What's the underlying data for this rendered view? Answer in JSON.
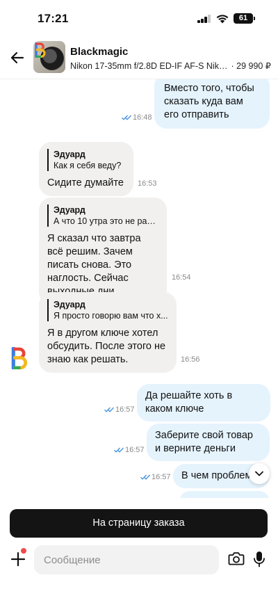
{
  "status": {
    "time": "17:21",
    "battery": "61"
  },
  "header": {
    "seller": "Blackmagic",
    "product": "Nikon 17-35mm f/2.8D ED-IF AF-S Nikkor...",
    "price": "· 29 990 ₽"
  },
  "messages": [
    {
      "dir": "out",
      "text": "Вместо того, чтобы сказать куда вам его отправить",
      "time": "16:48"
    },
    {
      "dir": "in",
      "quote_name": "Эдуард",
      "quote_text": "Как я себя веду?",
      "text": "Сидите думайте",
      "time": "16:53"
    },
    {
      "dir": "in",
      "quote_name": "Эдуард",
      "quote_text": "А что 10 утра это не раб...",
      "text": "Я сказал что завтра всё решим. Зачем писать снова. Это наглость. Сейчас выходные дни.",
      "time": "16:54"
    },
    {
      "dir": "in",
      "quote_name": "Эдуард",
      "quote_text": "Я просто говорю вам что х...",
      "text": "Я в другом ключе хотел обсудить. После этого не знаю как решать.",
      "time": "16:56"
    },
    {
      "dir": "out",
      "text": "Да решайте хоть в каком ключе",
      "time": "16:57"
    },
    {
      "dir": "out",
      "text": "Заберите свой товар и верните деньги",
      "time": "16:57"
    },
    {
      "dir": "out",
      "text": "В чем проблем",
      "time": "16:57"
    }
  ],
  "bottom": {
    "order_button": "На страницу заказа",
    "input_placeholder": "Сообщение"
  },
  "colors": {
    "outgoing": "#e5f3fd",
    "incoming": "#f1f0ee",
    "ticks": "#3d8fe0"
  },
  "icons": [
    "back-arrow-icon",
    "double-check-icon",
    "chevron-down-icon",
    "plus-icon",
    "camera-icon",
    "microphone-icon"
  ]
}
